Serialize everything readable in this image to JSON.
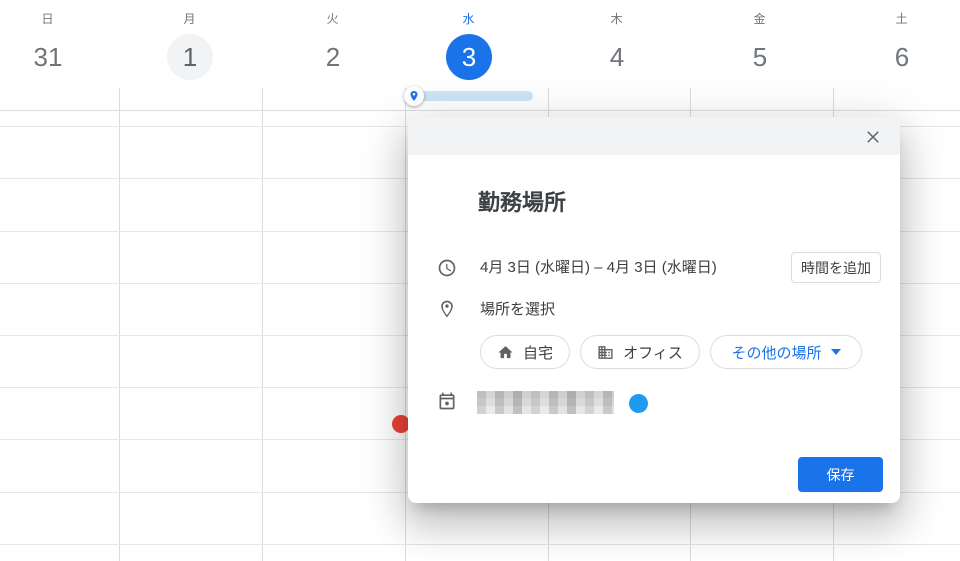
{
  "calendar": {
    "days": [
      {
        "weekday": "日",
        "date": "31"
      },
      {
        "weekday": "月",
        "date": "1"
      },
      {
        "weekday": "火",
        "date": "2"
      },
      {
        "weekday": "水",
        "date": "3"
      },
      {
        "weekday": "木",
        "date": "4"
      },
      {
        "weekday": "金",
        "date": "5"
      },
      {
        "weekday": "土",
        "date": "6"
      }
    ],
    "allday_event": {
      "icon": "location-pin-icon",
      "pill_color": "#cfe3f7"
    },
    "event_dot_color": "#ea4335"
  },
  "dialog": {
    "title": "勤務場所",
    "close_icon": "close-icon",
    "date_row": {
      "icon": "clock-icon",
      "date_range": "4月 3日 (水曜日) – 4月 3日 (水曜日)",
      "add_time_button": "時間を追加"
    },
    "location_row": {
      "icon": "location-pin-icon",
      "label": "場所を選択"
    },
    "chips": [
      {
        "label": "自宅",
        "icon": "home-icon"
      },
      {
        "label": "オフィス",
        "icon": "office-icon"
      },
      {
        "label": "その他の場所",
        "icon": "caret-down-icon"
      }
    ],
    "calendar_row": {
      "icon": "calendar-icon",
      "dot_color": "#1e9bf0"
    },
    "save_button": "保存"
  },
  "colors": {
    "accent": "#1a73e8",
    "selected_day_bg": "#1a73e8",
    "muted_day_bg": "#f1f3f4",
    "dialog_header_bg": "#f1f3f4",
    "border": "#dadce0",
    "text_primary": "#3c4043",
    "text_secondary": "#70757a"
  }
}
